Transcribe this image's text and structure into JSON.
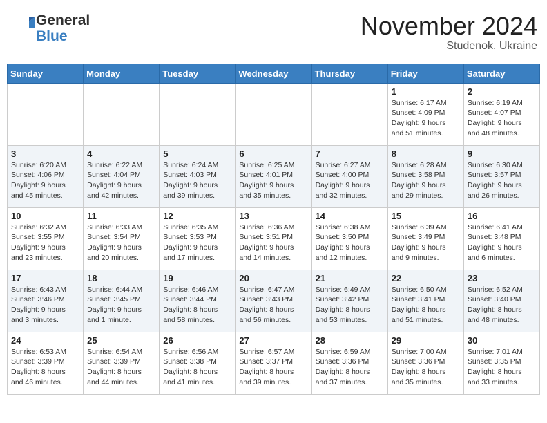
{
  "header": {
    "logo_general": "General",
    "logo_blue": "Blue",
    "month_title": "November 2024",
    "location": "Studenok, Ukraine"
  },
  "weekdays": [
    "Sunday",
    "Monday",
    "Tuesday",
    "Wednesday",
    "Thursday",
    "Friday",
    "Saturday"
  ],
  "weeks": [
    {
      "days": [
        {
          "num": "",
          "info": ""
        },
        {
          "num": "",
          "info": ""
        },
        {
          "num": "",
          "info": ""
        },
        {
          "num": "",
          "info": ""
        },
        {
          "num": "",
          "info": ""
        },
        {
          "num": "1",
          "info": "Sunrise: 6:17 AM\nSunset: 4:09 PM\nDaylight: 9 hours\nand 51 minutes."
        },
        {
          "num": "2",
          "info": "Sunrise: 6:19 AM\nSunset: 4:07 PM\nDaylight: 9 hours\nand 48 minutes."
        }
      ]
    },
    {
      "days": [
        {
          "num": "3",
          "info": "Sunrise: 6:20 AM\nSunset: 4:06 PM\nDaylight: 9 hours\nand 45 minutes."
        },
        {
          "num": "4",
          "info": "Sunrise: 6:22 AM\nSunset: 4:04 PM\nDaylight: 9 hours\nand 42 minutes."
        },
        {
          "num": "5",
          "info": "Sunrise: 6:24 AM\nSunset: 4:03 PM\nDaylight: 9 hours\nand 39 minutes."
        },
        {
          "num": "6",
          "info": "Sunrise: 6:25 AM\nSunset: 4:01 PM\nDaylight: 9 hours\nand 35 minutes."
        },
        {
          "num": "7",
          "info": "Sunrise: 6:27 AM\nSunset: 4:00 PM\nDaylight: 9 hours\nand 32 minutes."
        },
        {
          "num": "8",
          "info": "Sunrise: 6:28 AM\nSunset: 3:58 PM\nDaylight: 9 hours\nand 29 minutes."
        },
        {
          "num": "9",
          "info": "Sunrise: 6:30 AM\nSunset: 3:57 PM\nDaylight: 9 hours\nand 26 minutes."
        }
      ]
    },
    {
      "days": [
        {
          "num": "10",
          "info": "Sunrise: 6:32 AM\nSunset: 3:55 PM\nDaylight: 9 hours\nand 23 minutes."
        },
        {
          "num": "11",
          "info": "Sunrise: 6:33 AM\nSunset: 3:54 PM\nDaylight: 9 hours\nand 20 minutes."
        },
        {
          "num": "12",
          "info": "Sunrise: 6:35 AM\nSunset: 3:53 PM\nDaylight: 9 hours\nand 17 minutes."
        },
        {
          "num": "13",
          "info": "Sunrise: 6:36 AM\nSunset: 3:51 PM\nDaylight: 9 hours\nand 14 minutes."
        },
        {
          "num": "14",
          "info": "Sunrise: 6:38 AM\nSunset: 3:50 PM\nDaylight: 9 hours\nand 12 minutes."
        },
        {
          "num": "15",
          "info": "Sunrise: 6:39 AM\nSunset: 3:49 PM\nDaylight: 9 hours\nand 9 minutes."
        },
        {
          "num": "16",
          "info": "Sunrise: 6:41 AM\nSunset: 3:48 PM\nDaylight: 9 hours\nand 6 minutes."
        }
      ]
    },
    {
      "days": [
        {
          "num": "17",
          "info": "Sunrise: 6:43 AM\nSunset: 3:46 PM\nDaylight: 9 hours\nand 3 minutes."
        },
        {
          "num": "18",
          "info": "Sunrise: 6:44 AM\nSunset: 3:45 PM\nDaylight: 9 hours\nand 1 minute."
        },
        {
          "num": "19",
          "info": "Sunrise: 6:46 AM\nSunset: 3:44 PM\nDaylight: 8 hours\nand 58 minutes."
        },
        {
          "num": "20",
          "info": "Sunrise: 6:47 AM\nSunset: 3:43 PM\nDaylight: 8 hours\nand 56 minutes."
        },
        {
          "num": "21",
          "info": "Sunrise: 6:49 AM\nSunset: 3:42 PM\nDaylight: 8 hours\nand 53 minutes."
        },
        {
          "num": "22",
          "info": "Sunrise: 6:50 AM\nSunset: 3:41 PM\nDaylight: 8 hours\nand 51 minutes."
        },
        {
          "num": "23",
          "info": "Sunrise: 6:52 AM\nSunset: 3:40 PM\nDaylight: 8 hours\nand 48 minutes."
        }
      ]
    },
    {
      "days": [
        {
          "num": "24",
          "info": "Sunrise: 6:53 AM\nSunset: 3:39 PM\nDaylight: 8 hours\nand 46 minutes."
        },
        {
          "num": "25",
          "info": "Sunrise: 6:54 AM\nSunset: 3:39 PM\nDaylight: 8 hours\nand 44 minutes."
        },
        {
          "num": "26",
          "info": "Sunrise: 6:56 AM\nSunset: 3:38 PM\nDaylight: 8 hours\nand 41 minutes."
        },
        {
          "num": "27",
          "info": "Sunrise: 6:57 AM\nSunset: 3:37 PM\nDaylight: 8 hours\nand 39 minutes."
        },
        {
          "num": "28",
          "info": "Sunrise: 6:59 AM\nSunset: 3:36 PM\nDaylight: 8 hours\nand 37 minutes."
        },
        {
          "num": "29",
          "info": "Sunrise: 7:00 AM\nSunset: 3:36 PM\nDaylight: 8 hours\nand 35 minutes."
        },
        {
          "num": "30",
          "info": "Sunrise: 7:01 AM\nSunset: 3:35 PM\nDaylight: 8 hours\nand 33 minutes."
        }
      ]
    }
  ]
}
